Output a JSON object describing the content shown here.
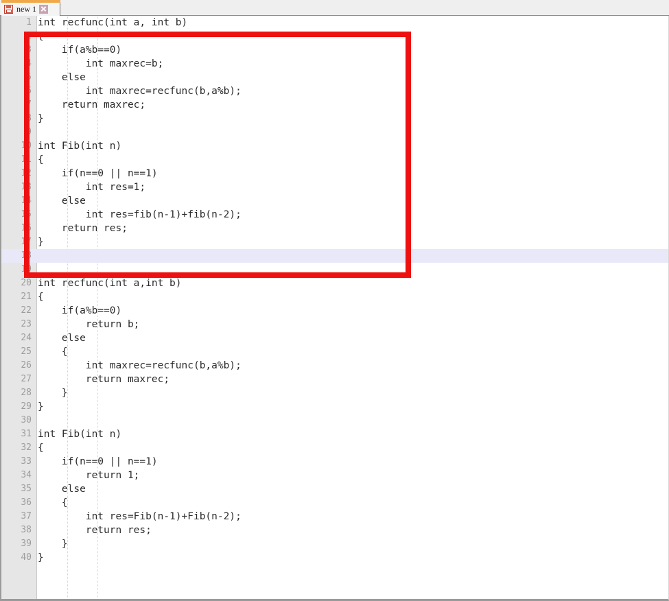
{
  "window": {
    "title": "new 1",
    "accent_orange": "#F0A849",
    "gutter_bg": "#E6E6E6",
    "current_line_bg": "#E8E8F8",
    "annotation_color": "#EE1111"
  },
  "tabbar": {
    "tabs": [
      {
        "label": "new 1",
        "save_icon": "save-floppy-icon",
        "close_icon": "close-x-icon",
        "active": true
      }
    ]
  },
  "editor": {
    "language": "C",
    "current_line": 18,
    "total_lines": 40,
    "annotation": {
      "shape": "rectangle",
      "color": "#EE1111",
      "covers_lines": "1-17"
    },
    "lines": [
      {
        "n": 1,
        "text": "int recfunc(int a, int b)"
      },
      {
        "n": 2,
        "text": "{"
      },
      {
        "n": 3,
        "text": "    if(a%b==0)"
      },
      {
        "n": 4,
        "text": "        int maxrec=b;"
      },
      {
        "n": 5,
        "text": "    else"
      },
      {
        "n": 6,
        "text": "        int maxrec=recfunc(b,a%b);"
      },
      {
        "n": 7,
        "text": "    return maxrec;"
      },
      {
        "n": 8,
        "text": "}"
      },
      {
        "n": 9,
        "text": ""
      },
      {
        "n": 10,
        "text": "int Fib(int n)"
      },
      {
        "n": 11,
        "text": "{"
      },
      {
        "n": 12,
        "text": "    if(n==0 || n==1)"
      },
      {
        "n": 13,
        "text": "        int res=1;"
      },
      {
        "n": 14,
        "text": "    else"
      },
      {
        "n": 15,
        "text": "        int res=fib(n-1)+fib(n-2);"
      },
      {
        "n": 16,
        "text": "    return res;"
      },
      {
        "n": 17,
        "text": "}"
      },
      {
        "n": 18,
        "text": ""
      },
      {
        "n": 19,
        "text": ""
      },
      {
        "n": 20,
        "text": "int recfunc(int a,int b)"
      },
      {
        "n": 21,
        "text": "{"
      },
      {
        "n": 22,
        "text": "    if(a%b==0)"
      },
      {
        "n": 23,
        "text": "        return b;"
      },
      {
        "n": 24,
        "text": "    else"
      },
      {
        "n": 25,
        "text": "    {"
      },
      {
        "n": 26,
        "text": "        int maxrec=recfunc(b,a%b);"
      },
      {
        "n": 27,
        "text": "        return maxrec;"
      },
      {
        "n": 28,
        "text": "    }"
      },
      {
        "n": 29,
        "text": "}"
      },
      {
        "n": 30,
        "text": ""
      },
      {
        "n": 31,
        "text": "int Fib(int n)"
      },
      {
        "n": 32,
        "text": "{"
      },
      {
        "n": 33,
        "text": "    if(n==0 || n==1)"
      },
      {
        "n": 34,
        "text": "        return 1;"
      },
      {
        "n": 35,
        "text": "    else"
      },
      {
        "n": 36,
        "text": "    {"
      },
      {
        "n": 37,
        "text": "        int res=Fib(n-1)+Fib(n-2);"
      },
      {
        "n": 38,
        "text": "        return res;"
      },
      {
        "n": 39,
        "text": "    }"
      },
      {
        "n": 40,
        "text": "}"
      }
    ]
  }
}
